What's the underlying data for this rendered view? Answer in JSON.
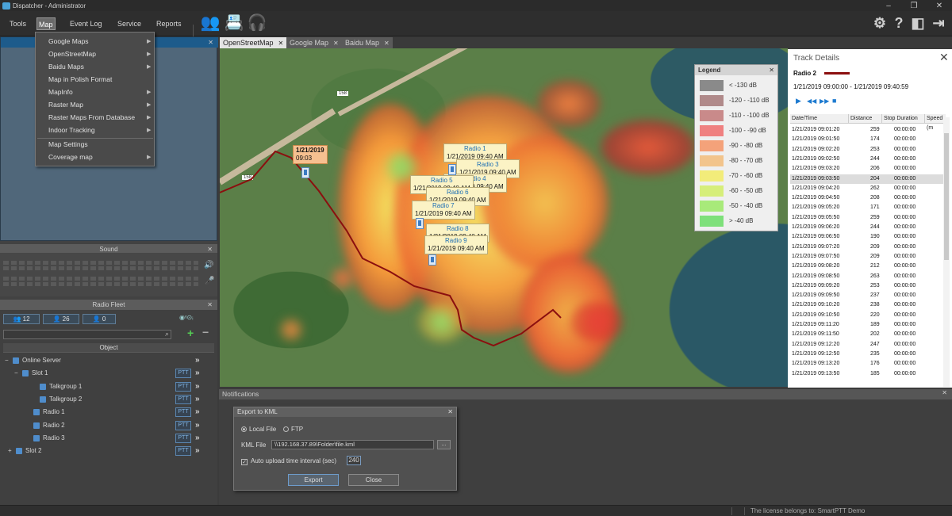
{
  "window": {
    "title": "Dispatcher - Administrator"
  },
  "menu": {
    "tools": "Tools",
    "map": "Map",
    "event_log": "Event Log",
    "service": "Service",
    "reports": "Reports"
  },
  "map_menu": {
    "items": [
      "Google Maps",
      "OpenStreetMap",
      "Baidu Maps",
      "Map in Polish Format",
      "MapInfo",
      "Raster Map",
      "Raster Maps From Database",
      "Indoor Tracking"
    ],
    "extra": [
      "Map Settings",
      "Coverage map"
    ]
  },
  "panels": {
    "sound": "Sound",
    "radio_fleet": "Radio Fleet"
  },
  "fleet": {
    "counts": [
      "12",
      "26",
      "0"
    ],
    "object_header": "Object",
    "tree": [
      {
        "label": "Online Server",
        "ptt": ""
      },
      {
        "label": "Slot 1",
        "ptt": "PTT"
      },
      {
        "label": "Talkgroup 1",
        "ptt": "PTT"
      },
      {
        "label": "Talkgroup 2",
        "ptt": "PTT"
      },
      {
        "label": "Radio 1",
        "ptt": "PTT"
      },
      {
        "label": "Radio 2",
        "ptt": "PTT"
      },
      {
        "label": "Radio 3",
        "ptt": "PTT"
      },
      {
        "label": "Slot 2",
        "ptt": "PTT"
      }
    ]
  },
  "map_tabs": [
    "OpenStreetMap",
    "Google Map",
    "Baidu Map"
  ],
  "map_labels": {
    "road_1": "158",
    "road_2": "158",
    "track_start": {
      "date": "1/21/2019",
      "time": "09:03"
    },
    "callouts": [
      {
        "name": "Radio 1",
        "time": "1/21/2019 09:40 AM"
      },
      {
        "name": "Radio 3",
        "time": "1/21/2019 09:40 AM"
      },
      {
        "name": "Radio 4",
        "time": "1/21/2019 09:40 AM"
      },
      {
        "name": "Radio 5",
        "time": "1/21/2019 09:40 AM"
      },
      {
        "name": "Radio 6",
        "time": "1/21/2019 09:40 AM"
      },
      {
        "name": "Radio 7",
        "time": "1/21/2019 09:40 AM"
      },
      {
        "name": "Radio 8",
        "time": "1/21/2019 09:40 AM"
      },
      {
        "name": "Radio 9",
        "time": "1/21/2019 09:40 AM"
      }
    ]
  },
  "legend": {
    "title": "Legend",
    "entries": [
      {
        "label": "< -130 dB",
        "color": "#8a8a8a"
      },
      {
        "label": "-120 - -110 dB",
        "color": "#b08a8a"
      },
      {
        "label": "-110 - -100 dB",
        "color": "#c98a8a"
      },
      {
        "label": "-100 - -90 dB",
        "color": "#ef8080"
      },
      {
        "label": "-90 - -80 dB",
        "color": "#f4a27a"
      },
      {
        "label": "-80 - -70 dB",
        "color": "#f2c48c"
      },
      {
        "label": "-70 - -60 dB",
        "color": "#f2ec7a"
      },
      {
        "label": "-60 - -50 dB",
        "color": "#d6ee7a"
      },
      {
        "label": "-50 - -40 dB",
        "color": "#a8ea7a"
      },
      {
        "label": "> -40 dB",
        "color": "#7ee07a"
      }
    ]
  },
  "track_details": {
    "title": "Track Details",
    "radio": "Radio 2",
    "track_color": "#8b0f0f",
    "range": "1/21/2019 09:00:00 - 1/21/2019 09:40:59",
    "columns": [
      "Date/Time",
      "Distance",
      "Stop Duration",
      "Speed (m"
    ],
    "rows": [
      [
        "1/21/2019 09:01:20",
        "259",
        "00:00:00"
      ],
      [
        "1/21/2019 09:01:50",
        "174",
        "00:00:00"
      ],
      [
        "1/21/2019 09:02:20",
        "253",
        "00:00:00"
      ],
      [
        "1/21/2019 09:02:50",
        "244",
        "00:00:00"
      ],
      [
        "1/21/2019 09:03:20",
        "206",
        "00:00:00"
      ],
      [
        "1/21/2019 09:03:50",
        "204",
        "00:00:00"
      ],
      [
        "1/21/2019 09:04:20",
        "262",
        "00:00:00"
      ],
      [
        "1/21/2019 09:04:50",
        "208",
        "00:00:00"
      ],
      [
        "1/21/2019 09:05:20",
        "171",
        "00:00:00"
      ],
      [
        "1/21/2019 09:05:50",
        "259",
        "00:00:00"
      ],
      [
        "1/21/2019 09:06:20",
        "244",
        "00:00:00"
      ],
      [
        "1/21/2019 09:06:50",
        "190",
        "00:00:00"
      ],
      [
        "1/21/2019 09:07:20",
        "209",
        "00:00:00"
      ],
      [
        "1/21/2019 09:07:50",
        "209",
        "00:00:00"
      ],
      [
        "1/21/2019 09:08:20",
        "212",
        "00:00:00"
      ],
      [
        "1/21/2019 09:08:50",
        "263",
        "00:00:00"
      ],
      [
        "1/21/2019 09:09:20",
        "253",
        "00:00:00"
      ],
      [
        "1/21/2019 09:09:50",
        "237",
        "00:00:00"
      ],
      [
        "1/21/2019 09:10:20",
        "238",
        "00:00:00"
      ],
      [
        "1/21/2019 09:10:50",
        "220",
        "00:00:00"
      ],
      [
        "1/21/2019 09:11:20",
        "189",
        "00:00:00"
      ],
      [
        "1/21/2019 09:11:50",
        "202",
        "00:00:00"
      ],
      [
        "1/21/2019 09:12:20",
        "247",
        "00:00:00"
      ],
      [
        "1/21/2019 09:12:50",
        "235",
        "00:00:00"
      ],
      [
        "1/21/2019 09:13:20",
        "176",
        "00:00:00"
      ],
      [
        "1/21/2019 09:13:50",
        "185",
        "00:00:00"
      ]
    ],
    "selected_row": 5
  },
  "notifications": {
    "title": "Notifications"
  },
  "export_dialog": {
    "title": "Export to KML",
    "local_file": "Local File",
    "ftp": "FTP",
    "kml_file_label": "KML File",
    "kml_file_value": "\\\\192.168.37.89\\Folder\\file.kml",
    "browse": "...",
    "auto_upload_label": "Auto upload time interval (sec)",
    "auto_upload_value": "240",
    "export": "Export",
    "close": "Close"
  },
  "status": {
    "license": "The license belongs to:  SmartPTT Demo"
  }
}
